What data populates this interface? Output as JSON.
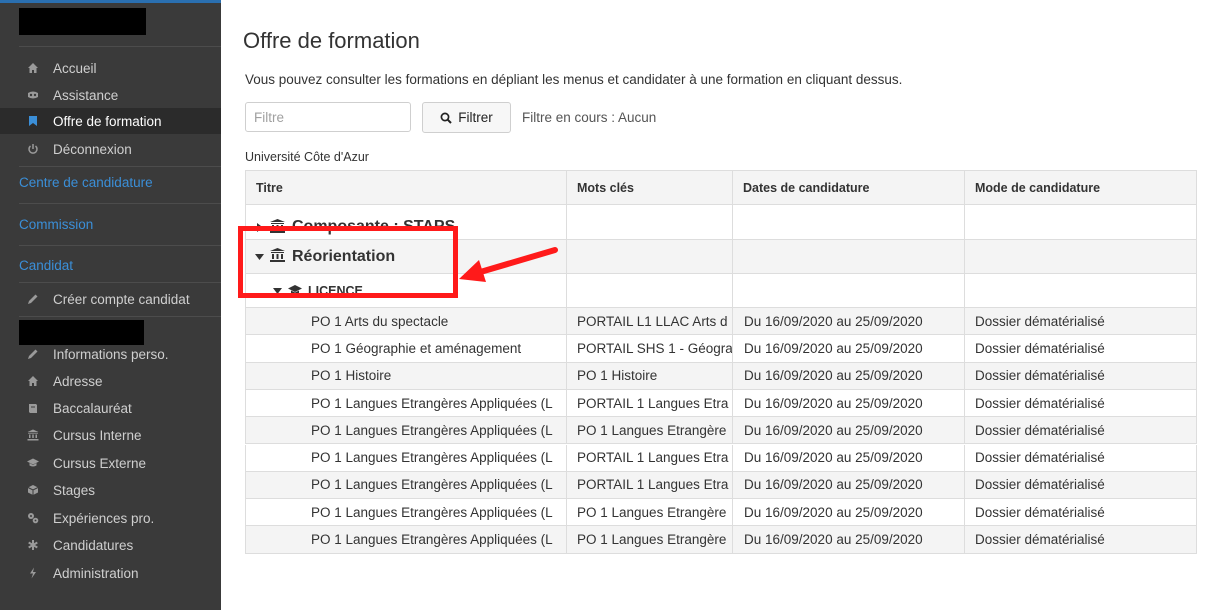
{
  "sidebar": {
    "items_top": [
      {
        "label": "Accueil",
        "icon": "home-icon",
        "active": false
      },
      {
        "label": "Assistance",
        "icon": "support-icon",
        "active": false
      },
      {
        "label": "Offre de formation",
        "icon": "bookmark-icon",
        "active": true
      },
      {
        "label": "Déconnexion",
        "icon": "power-icon",
        "active": false
      }
    ],
    "sections": [
      "Centre de candidature",
      "Commission",
      "Candidat"
    ],
    "create_account": "Créer compte candidat",
    "candidate_items": [
      {
        "label": "Informations perso.",
        "icon": "pencil-icon"
      },
      {
        "label": "Adresse",
        "icon": "home-icon"
      },
      {
        "label": "Baccalauréat",
        "icon": "book-icon"
      },
      {
        "label": "Cursus Interne",
        "icon": "institution-icon"
      },
      {
        "label": "Cursus Externe",
        "icon": "graduation-cap-icon"
      },
      {
        "label": "Stages",
        "icon": "cube-icon"
      },
      {
        "label": "Expériences pro.",
        "icon": "cogs-icon"
      },
      {
        "label": "Candidatures",
        "icon": "asterisk-icon"
      },
      {
        "label": "Administration",
        "icon": "bolt-icon"
      }
    ],
    "accent_color": "#3b8fd8"
  },
  "main": {
    "title": "Offre de formation",
    "intro": "Vous pouvez consulter les formations en dépliant les menus et candidater à une formation en cliquant dessus.",
    "filter_placeholder": "Filtre",
    "filter_button": "Filtrer",
    "filter_status": "Filtre en cours : Aucun",
    "university": "Université Côte d'Azur"
  },
  "table": {
    "headers": [
      "Titre",
      "Mots clés",
      "Dates de candidature",
      "Mode de candidature"
    ],
    "composante": "Composante : STAPS",
    "reorientation": "Réorientation",
    "licence": "LICENCE",
    "rows": [
      [
        "PO 1 Arts du spectacle",
        "PORTAIL L1 LLAC Arts d",
        "Du 16/09/2020 au 25/09/2020",
        "Dossier dématérialisé"
      ],
      [
        "PO 1 Géographie et aménagement",
        "PORTAIL SHS 1 - Géogra",
        "Du 16/09/2020 au 25/09/2020",
        "Dossier dématérialisé"
      ],
      [
        "PO 1 Histoire",
        "PO 1 Histoire",
        "Du 16/09/2020 au 25/09/2020",
        "Dossier dématérialisé"
      ],
      [
        "PO 1 Langues Etrangères Appliquées (L",
        "PORTAIL 1 Langues Etra",
        "Du 16/09/2020 au 25/09/2020",
        "Dossier dématérialisé"
      ],
      [
        "PO 1 Langues Etrangères Appliquées (L",
        "PO 1 Langues Etrangère",
        "Du 16/09/2020 au 25/09/2020",
        "Dossier dématérialisé"
      ],
      [
        "PO 1 Langues Etrangères Appliquées (L",
        "PORTAIL 1 Langues Etra",
        "Du 16/09/2020 au 25/09/2020",
        "Dossier dématérialisé"
      ],
      [
        "PO 1 Langues Etrangères Appliquées (L",
        "PORTAIL 1 Langues Etra",
        "Du 16/09/2020 au 25/09/2020",
        "Dossier dématérialisé"
      ],
      [
        "PO 1 Langues Etrangères Appliquées (L",
        "PO 1 Langues Etrangère",
        "Du 16/09/2020 au 25/09/2020",
        "Dossier dématérialisé"
      ],
      [
        "PO 1 Langues Etrangères Appliquées (L",
        "PO 1 Langues Etrangère",
        "Du 16/09/2020 au 25/09/2020",
        "Dossier dématérialisé"
      ]
    ]
  },
  "annotation": {
    "color": "#ff1a1a"
  }
}
